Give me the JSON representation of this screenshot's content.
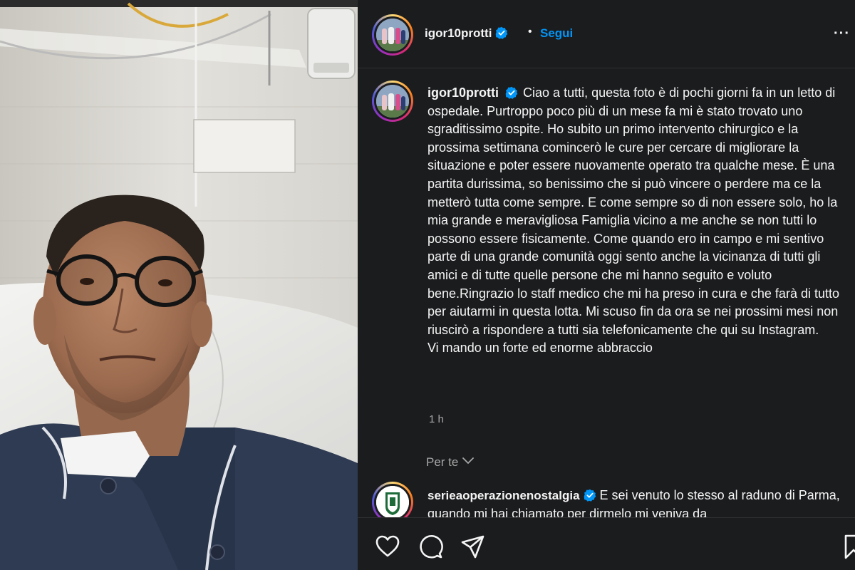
{
  "post": {
    "author": {
      "username": "igor10protti",
      "verified": true,
      "follow_label": "Segui"
    },
    "separator": "•",
    "more_label": "···",
    "caption": "Ciao a tutti, questa foto è di pochi giorni fa in un letto di ospedale. Purtroppo poco più di un mese fa mi è stato trovato uno sgraditissimo ospite. Ho subito un primo intervento chirurgico e la prossima settimana comincerò le cure per cercare di migliorare la situazione e poter essere nuovamente operato tra qualche mese. È una partita durissima, so benissimo che si può vincere o perdere ma ce la metterò tutta come sempre. E come sempre so di non essere solo, ho la mia grande e meravigliosa Famiglia vicino a me anche se non tutti lo possono essere fisicamente. Come quando ero in campo e mi sentivo parte di una grande comunità oggi sento anche la vicinanza di tutti gli amici e di tutte quelle persone che mi hanno seguito e voluto bene.Ringrazio lo staff medico che mi ha preso in cura e che farà di tutto per aiutarmi in questa lotta. Mi scuso fin da ora se nei prossimi mesi non riuscirò a rispondere a tutti sia telefonicamente che qui su Instagram.",
    "caption_last_line": "Vi mando un forte ed enorme abbraccio",
    "timestamp": "1 h"
  },
  "comments_filter": {
    "label": "Per te"
  },
  "comments": [
    {
      "username": "serieaoperazionenostalgia",
      "verified": true,
      "text": "E sei venuto lo stesso al raduno di Parma, quando mi hai chiamato per dirmelo mi veniva da"
    }
  ],
  "actions": {
    "icons": [
      "heart-icon",
      "comment-icon",
      "share-icon",
      "bookmark-icon"
    ]
  },
  "colors": {
    "accent": "#0095f6",
    "verified": "#0095f6",
    "panel_bg": "#1b1c1e",
    "muted_text": "#a8a8a8"
  }
}
